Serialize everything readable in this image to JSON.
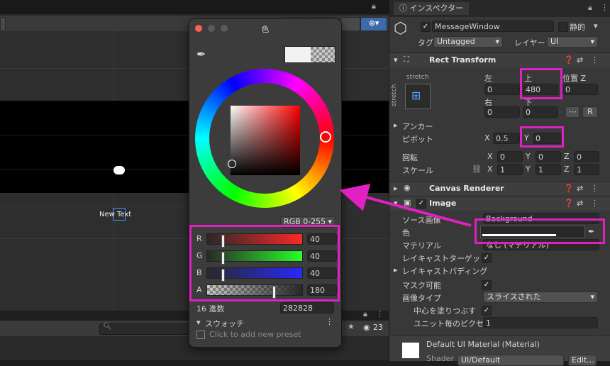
{
  "picker": {
    "title": "色",
    "color_mode": "RGB 0-255",
    "channels": [
      {
        "label": "R",
        "value": "40",
        "level": 0.157
      },
      {
        "label": "G",
        "value": "40",
        "level": 0.157
      },
      {
        "label": "B",
        "value": "40",
        "level": 0.157
      },
      {
        "label": "A",
        "value": "180",
        "level": 0.706
      }
    ],
    "hex_label": "16 進数",
    "hex_value": "282828",
    "swatches_label": "スウォッチ",
    "swatches_hint": "Click to add new preset"
  },
  "scene": {
    "new_text": "New Text",
    "visibility_count": "23"
  },
  "inspector": {
    "tab_label": "インスペクター",
    "object_name": "MessageWindow",
    "static_label": "静的",
    "tag_label": "タグ",
    "tag_value": "Untagged",
    "layer_label": "レイヤー",
    "layer_value": "UI",
    "rect_transform": {
      "title": "Rect Transform",
      "stretch_top": "stretch",
      "stretch_side": "stretch",
      "left_label": "左",
      "top_label": "上",
      "posz_label": "位置 Z",
      "left_value": "0",
      "top_value": "480",
      "posz_value": "0",
      "right_label": "右",
      "bottom_label": "下",
      "right_value": "0",
      "bottom_value": "0",
      "anchor_label": "アンカー",
      "pivot_label": "ピボット",
      "pivot_x": "0.5",
      "pivot_y": "0",
      "rotation_label": "回転",
      "rot_x": "0",
      "rot_y": "0",
      "rot_z": "0",
      "scale_label": "スケール",
      "scale_x": "1",
      "scale_y": "1",
      "scale_z": "1",
      "x_label": "X",
      "y_label": "Y",
      "z_label": "Z",
      "r_button": "R"
    },
    "canvas_renderer": {
      "title": "Canvas Renderer"
    },
    "image": {
      "title": "Image",
      "source_label": "ソース画像",
      "source_value": "Background",
      "color_label": "色",
      "material_label": "マテリアル",
      "material_value": "なし (マテリアル)",
      "raycast_target_label": "レイキャストターゲット",
      "raycast_padding_label": "レイキャストパディング",
      "maskable_label": "マスク可能",
      "image_type_label": "画像タイプ",
      "image_type_value": "スライスされた",
      "fill_center_label": "中心を塗りつぶす",
      "ppu_label": "ユニット毎のピクセル",
      "ppu_value": "1"
    },
    "material_footer": {
      "title": "Default UI Material (Material)",
      "shader_label": "Shader",
      "shader_value": "UI/Default",
      "edit_button": "Edit..."
    }
  },
  "colors": {
    "highlight": "#e020c0",
    "swatch": "#282828"
  }
}
